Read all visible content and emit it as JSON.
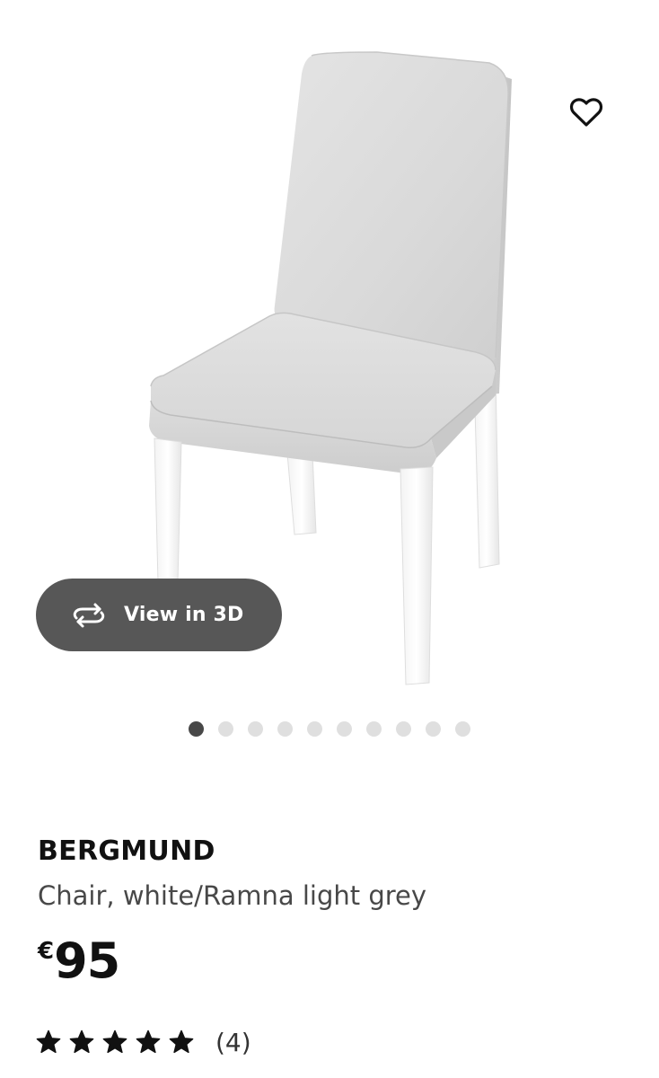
{
  "product": {
    "name": "BERGMUND",
    "description": "Chair, white/Ramna light grey",
    "price": {
      "currency": "€",
      "amount": "95"
    },
    "rating": {
      "stars": 5,
      "max_stars": 5,
      "review_count": "(4)"
    }
  },
  "media": {
    "view_3d_label": "View in 3D",
    "favourite_icon": "heart-outline-icon",
    "view_3d_icon": "rotate-arrows-icon",
    "carousel": {
      "total_images": 10,
      "active_index": 0
    }
  },
  "colors": {
    "view_3d_background": "#575757",
    "active_dot": "#484848",
    "inactive_dot": "#dfdfdf",
    "text_primary": "#111111",
    "text_secondary": "#484848"
  }
}
